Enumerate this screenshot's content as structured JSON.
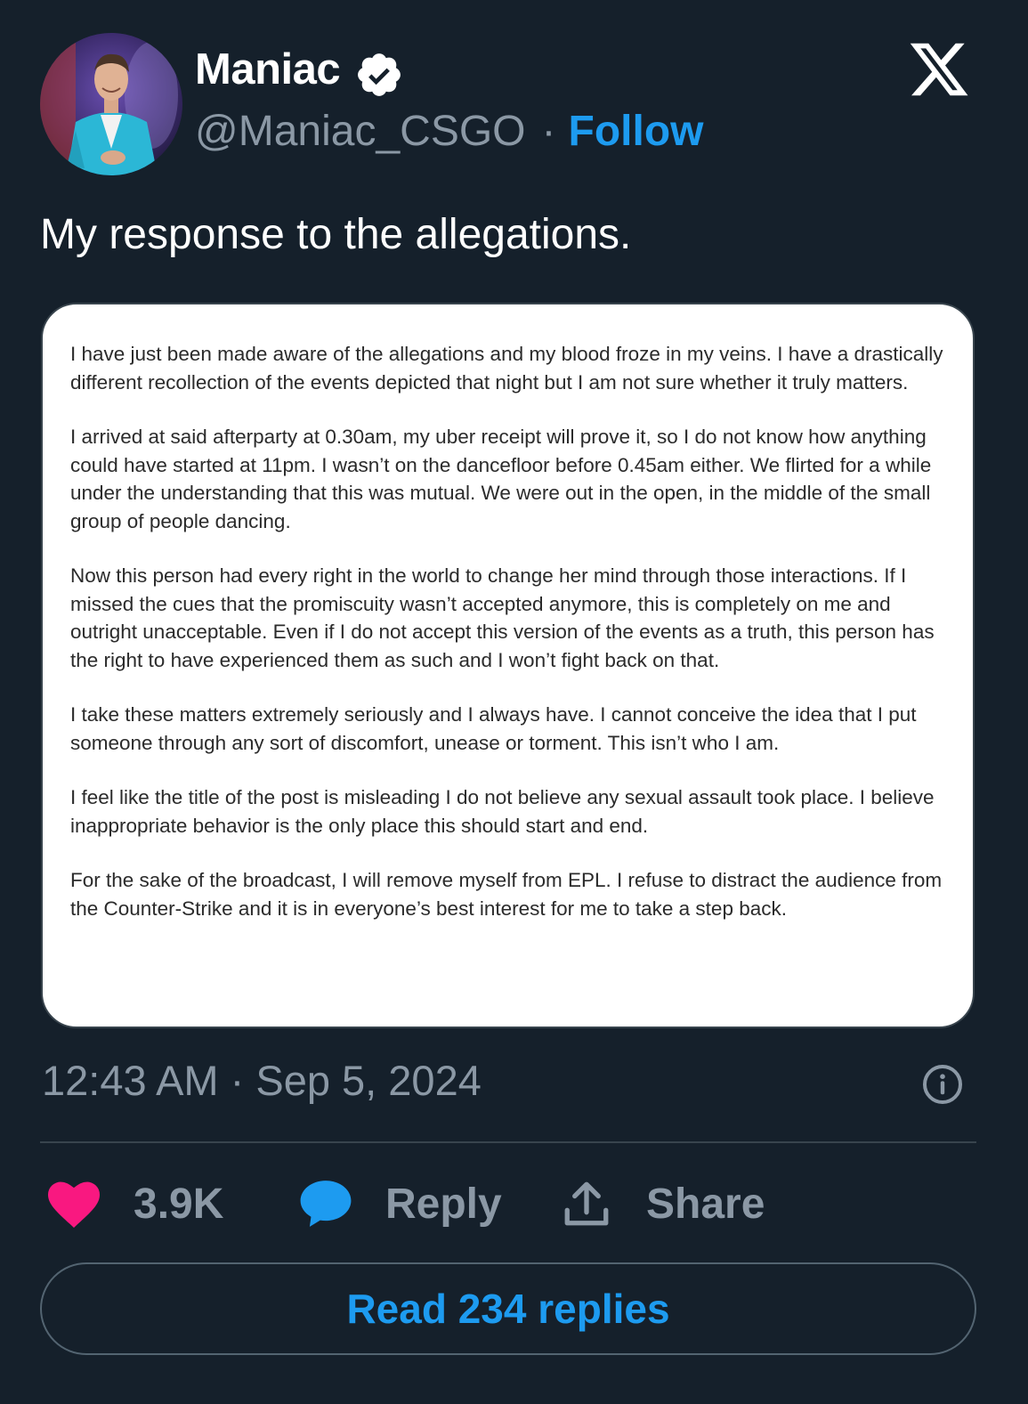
{
  "author": {
    "display_name": "Maniac",
    "handle": "@Maniac_CSGO",
    "separator": "·",
    "follow_label": "Follow"
  },
  "tweet": {
    "text": "My response to the allegations.",
    "statement_paragraphs": [
      "I have just been made aware of the allegations and my blood froze in my veins. I have a drastically different recollection of the events depicted that night but I am not sure whether it truly matters.",
      "I arrived at said afterparty at 0.30am, my uber receipt will prove it, so I do not know how anything could have started at 11pm. I wasn’t on the dancefloor before 0.45am either. We flirted for a while under the understanding that this was mutual. We were out in the open, in the middle of the small group of people dancing.",
      "Now this person had every right in the world to change her mind through those interactions. If I missed the cues that the promiscuity wasn’t accepted anymore, this is completely on me and outright unacceptable. Even if I do not accept this version of the events as a truth, this person has the right to have experienced them as such and I won’t fight back on that.",
      "I take these matters extremely seriously and I always have. I cannot conceive the idea that I put someone through any sort of discomfort, unease or torment. This isn’t who I am.",
      "I feel like the title of the post is misleading I do not believe any sexual assault took place. I believe inappropriate behavior is the only place this should start and end.",
      "For the sake of the broadcast, I will remove myself from EPL. I refuse to distract the audience from the Counter-Strike and it is in everyone’s best interest for me to take a step back."
    ],
    "timestamp": "12:43 AM · Sep 5, 2024"
  },
  "actions": {
    "like_count": "3.9K",
    "reply_label": "Reply",
    "share_label": "Share"
  },
  "read_replies_label": "Read 234 replies",
  "icons": {
    "avatar": "profile-photo",
    "verified": "verified-badge-icon",
    "logo": "x-logo-icon",
    "info": "info-icon",
    "like": "heart-icon",
    "reply": "speech-bubble-icon",
    "share": "share-upload-icon"
  },
  "colors": {
    "background": "#15202b",
    "accent": "#1d9bf0",
    "like": "#f91880",
    "muted": "#8b98a5"
  }
}
